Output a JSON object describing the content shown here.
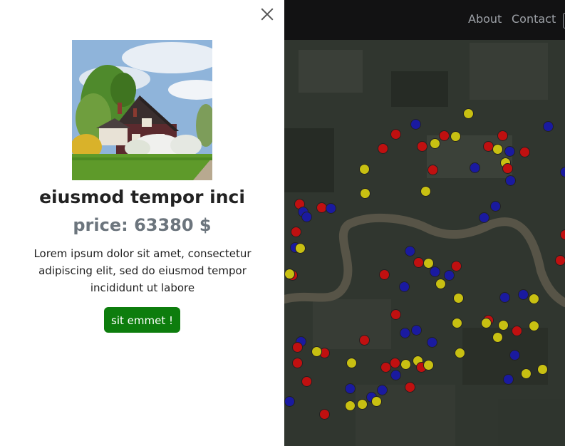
{
  "nav": {
    "about": "About",
    "contact": "Contact"
  },
  "listing": {
    "title": "eiusmod tempor inci",
    "price": "price: 63380 $",
    "description": "Lorem ipsum dolor sit amet, consectetur adipiscing elit, sed do eiusmod tempor incididunt ut labore",
    "button": "sit emmet !"
  },
  "marker_colors": {
    "red": "#c01010",
    "blue": "#1a1aa0",
    "yellow": "#c8c012"
  },
  "colors": {
    "button": "#0d7d0d",
    "navbar": "#121213",
    "map": "#2d322c"
  }
}
